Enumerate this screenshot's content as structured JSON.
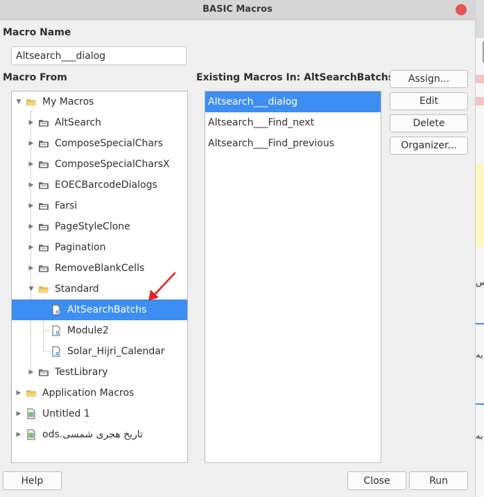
{
  "window": {
    "title": "BASIC Macros"
  },
  "macro_name": {
    "label": "Macro Name",
    "value": "Altsearch___dialog"
  },
  "macro_from": {
    "label": "Macro From",
    "tree": [
      {
        "label": "My Macros",
        "icon": "folder-open-icon",
        "expanded": true
      },
      {
        "label": "AltSearch",
        "icon": "library-icon"
      },
      {
        "label": "ComposeSpecialChars",
        "icon": "library-icon"
      },
      {
        "label": "ComposeSpecialCharsX",
        "icon": "library-icon"
      },
      {
        "label": "EOECBarcodeDialogs",
        "icon": "library-icon"
      },
      {
        "label": "Farsi",
        "icon": "library-icon"
      },
      {
        "label": "PageStyleClone",
        "icon": "library-icon"
      },
      {
        "label": "Pagination",
        "icon": "library-icon"
      },
      {
        "label": "RemoveBlankCells",
        "icon": "library-icon"
      },
      {
        "label": "Standard",
        "icon": "folder-open-icon",
        "expanded": true
      },
      {
        "label": "AltSearchBatchs",
        "icon": "module-icon",
        "selected": true
      },
      {
        "label": "Module2",
        "icon": "module-icon"
      },
      {
        "label": "Solar_Hijri_Calendar",
        "icon": "module-icon"
      },
      {
        "label": "TestLibrary",
        "icon": "library-icon"
      },
      {
        "label": "Application Macros",
        "icon": "folder-icon"
      },
      {
        "label": "Untitled 1",
        "icon": "spreadsheet-icon"
      },
      {
        "label": "تاریخ هجری شمسی.ods",
        "icon": "spreadsheet-icon"
      }
    ]
  },
  "existing_macros": {
    "label": "Existing Macros In: AltSearchBatchs",
    "items": [
      "Altsearch___dialog",
      "Altsearch___Find_next",
      "Altsearch___Find_previous"
    ],
    "selected_index": 0
  },
  "buttons": {
    "assign": "Assign...",
    "edit": "Edit",
    "delete": "Delete",
    "organizer": "Organizer...",
    "help": "Help",
    "close": "Close",
    "run": "Run"
  },
  "background_strip": {
    "text1": "س",
    "text2": "به",
    "text3": "به"
  },
  "colors": {
    "selection": "#3d8ef0",
    "close_button": "#e75454",
    "annotation_arrow": "#e8201f"
  }
}
